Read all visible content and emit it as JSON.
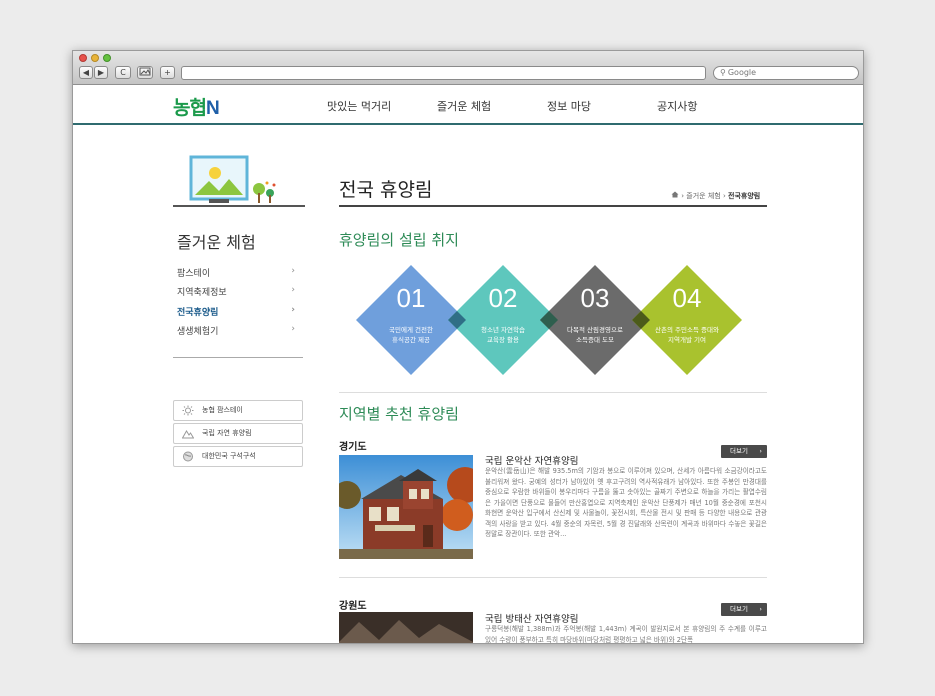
{
  "browser": {
    "search_placeholder": "Google",
    "back_btn": "◀",
    "forward_btn": "▶",
    "reload_btn": "C",
    "add_btn": "+"
  },
  "header": {
    "logo_main": "농협",
    "logo_accent": "N",
    "nav": [
      "맛있는 먹거리",
      "즐거운 체험",
      "정보 마당",
      "공지사항"
    ]
  },
  "sidebar": {
    "title": "즐거운 체험",
    "items": [
      {
        "label": "팜스테이"
      },
      {
        "label": "지역축제정보"
      },
      {
        "label": "전국휴양림"
      },
      {
        "label": "생생체험기"
      }
    ],
    "chevron": "›",
    "quick_links": [
      {
        "label": "농협 팜스테이",
        "icon": "sun-icon"
      },
      {
        "label": "국립 자연 휴양림",
        "icon": "mountain-icon"
      },
      {
        "label": "대한민국 구석구석",
        "icon": "globe-icon"
      }
    ]
  },
  "main": {
    "title": "전국 휴양림",
    "breadcrumb": {
      "home_icon": "home-icon",
      "sep": "›",
      "parent": "즐거운 체험",
      "current": "전국휴양림"
    },
    "purpose_title": "휴양림의 설립 취지",
    "purposes": [
      {
        "num": "01",
        "line1": "국민에게 건전한",
        "line2": "휴식공간 제공",
        "color": "#6f9fdc"
      },
      {
        "num": "02",
        "line1": "청소년 자연학습",
        "line2": "교육장 활용",
        "color": "#5ec7bd"
      },
      {
        "num": "03",
        "line1": "다목적 산림경영으로",
        "line2": "소득증대 도모",
        "color": "#6b6b6b"
      },
      {
        "num": "04",
        "line1": "산촌의 주민소득 증대와",
        "line2": "지역개발 기여",
        "color": "#a9c22e"
      }
    ],
    "recommend_title": "지역별 추천 휴양림",
    "more_label": "더보기",
    "more_arrow": "›",
    "recommendations": [
      {
        "region": "경기도",
        "name": "국립 운악산 자연휴양림",
        "desc": "운악산(雲岳山)은 해발 935.5m의 기암과 봉으로 이루어져 있으며, 산세가 아름다워 소금강이라고도 불리워져 왔다. 궁예의 성터가 남아있어 옛 후고구려의 역사적유래가 남아있다. 또한 주봉인 만경대를 중심으로 우람한 바위들이 봉우리마다 구름을 뚫고 솟아있는 골짜기 주변으로 하늘을 가리는 활엽수림은 가을이면 단풍으로 물들어 만산홍엽으로 지역축제인 운악산 단풍제가 매년 10월 중순경에 포천시 화현면 운악산 입구에서 산신제 및 사물놀이, 꽃전시회, 특산물 전시 및 판매 등 다양한 내용으로 관광객의 사랑을 받고 있다. 4월 중순의 자목련, 5월 경 진달래와 산목련이 계곡과 바위마다 수놓은 꽃길은 정말로 장관이다. 또한 관악..."
      },
      {
        "region": "강원도",
        "name": "국립 방태산 자연휴양림",
        "desc": "구룡덕봉(해발 1,388m)과 주억봉(해발 1,443m) 계곡이 발원지로서 본 휴양림의 주 수계를 이루고 있어 수량이 풍부하고 특히 마당바위(마당처럼 평평하고 넓은 바위)와 2단폭"
      }
    ]
  }
}
